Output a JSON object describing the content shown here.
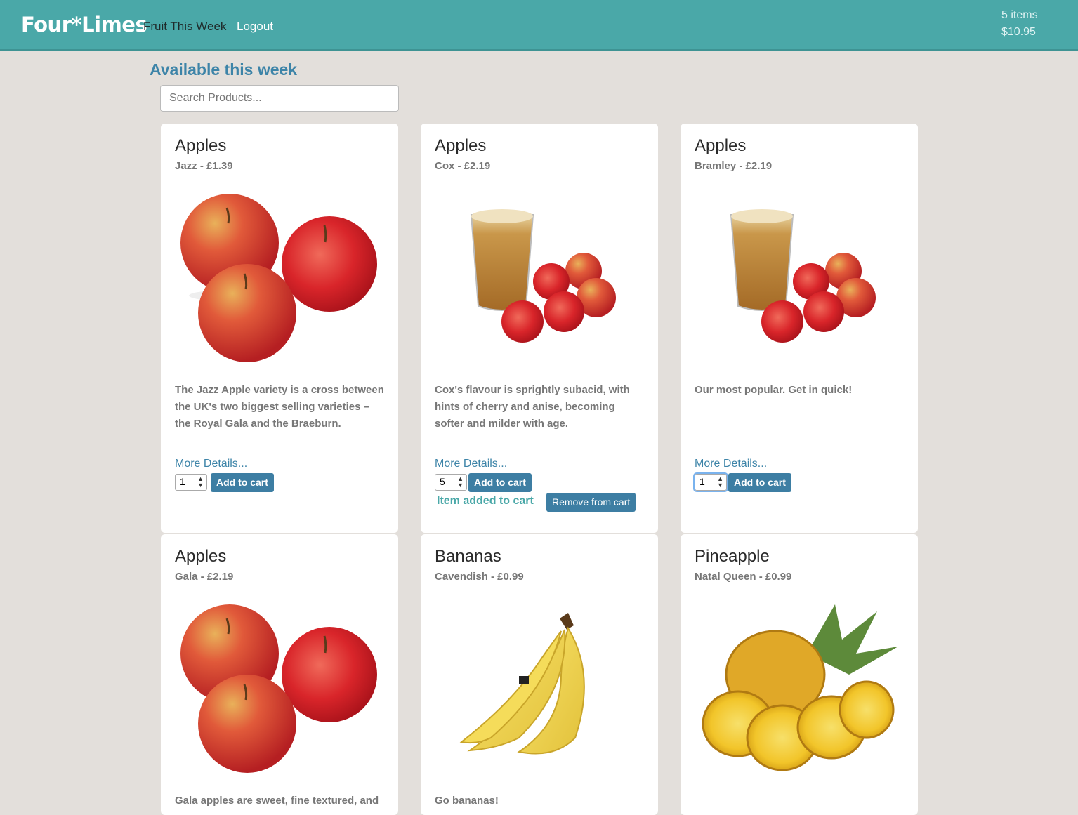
{
  "header": {
    "brand": "Four*Limes",
    "nav": [
      {
        "label": "Fruit This Week"
      },
      {
        "label": "Logout"
      }
    ],
    "cart_count": "5 items",
    "cart_total": "$10.95"
  },
  "main": {
    "title": "Available this week",
    "search_placeholder": "Search Products..."
  },
  "products": [
    {
      "name": "Apples",
      "subtitle": "Jazz - £1.39",
      "image": "three-apples",
      "description": "The Jazz Apple variety is a cross between the UK's two biggest selling varieties – the Royal Gala and the Braeburn.",
      "more": "More Details...",
      "qty": "1",
      "add": "Add to cart"
    },
    {
      "name": "Apples",
      "subtitle": "Cox - £2.19",
      "image": "apple-juice-with-apples",
      "description": "Cox's flavour is sprightly subacid, with hints of cherry and anise, becoming softer and milder with age.",
      "more": "More Details...",
      "qty": "5",
      "add": "Add to cart",
      "added_message": "Item added to cart",
      "remove": "Remove from cart"
    },
    {
      "name": "Apples",
      "subtitle": "Bramley - £2.19",
      "image": "apple-juice-with-apples",
      "description": "Our most popular. Get in quick!",
      "more": "More Details...",
      "qty": "1",
      "add": "Add to cart"
    },
    {
      "name": "Apples",
      "subtitle": "Gala - £2.19",
      "image": "three-apples",
      "description": "Gala apples are sweet, fine textured, and"
    },
    {
      "name": "Bananas",
      "subtitle": "Cavendish - £0.99",
      "image": "bananas",
      "description": "Go bananas!"
    },
    {
      "name": "Pineapple",
      "subtitle": "Natal Queen - £0.99",
      "image": "pineapple",
      "description": ""
    }
  ],
  "colors": {
    "navbar": "#4aa8a8",
    "accent": "#3d84a8",
    "button": "#3d7ea3",
    "background": "#e3dfdb"
  }
}
